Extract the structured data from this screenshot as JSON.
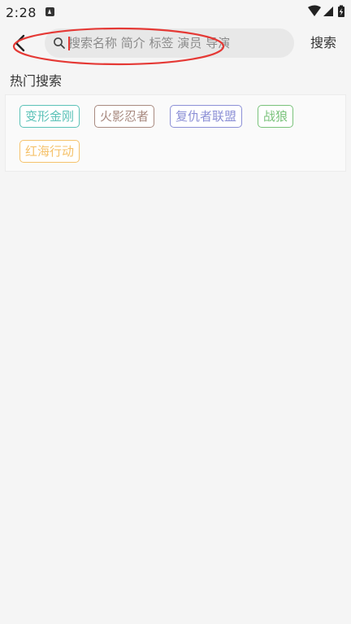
{
  "status_bar": {
    "time": "2:28",
    "icons": [
      "app-notification-icon",
      "wifi-icon",
      "cellular-signal-icon",
      "battery-charging-icon"
    ]
  },
  "header": {
    "back_icon": "chevron-left-icon",
    "search_icon": "search-icon",
    "search_placeholder": "搜索名称 简介 标签 演员 导演",
    "search_value": "",
    "search_button_label": "搜索"
  },
  "hot_search": {
    "title": "热门搜索",
    "tags": [
      {
        "label": "变形金刚",
        "color": "#5cc2b8"
      },
      {
        "label": "火影忍者",
        "color": "#a88a80"
      },
      {
        "label": "复仇者联盟",
        "color": "#8c90d6"
      },
      {
        "label": "战狼",
        "color": "#79c27a"
      },
      {
        "label": "红海行动",
        "color": "#f5c26b"
      }
    ]
  },
  "colors": {
    "background": "#f5f5f5",
    "search_box": "#e8e8e8",
    "annotation": "#e53935"
  }
}
